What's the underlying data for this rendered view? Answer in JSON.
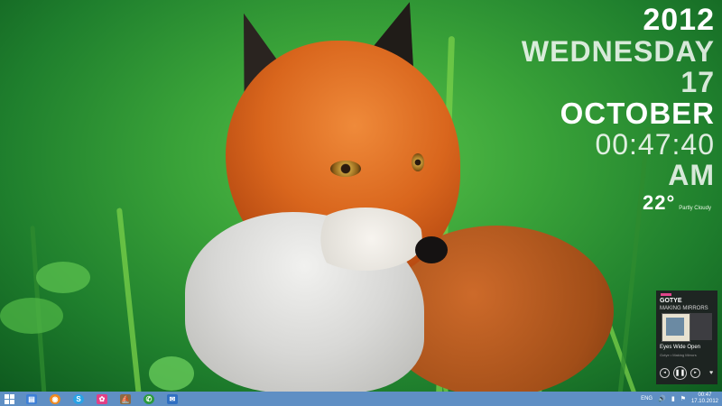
{
  "widget_clock": {
    "year": "2012",
    "weekday": "WEDNESDAY",
    "day": "17",
    "month": "OCTOBER",
    "time": "00:47:40",
    "ampm": "AM"
  },
  "weather": {
    "temperature": "22°",
    "condition": "Partly Cloudy"
  },
  "music": {
    "artist": "GOTYE",
    "album": "MAKING MIRRORS",
    "track": "Eyes Wide Open",
    "sub": "Gotye • Making Mirrors"
  },
  "taskbar": {
    "icons": [
      "windows-start-icon",
      "explorer-icon",
      "firefox-icon",
      "skype-icon",
      "flower-app-icon",
      "ship-app-icon",
      "chat-app-icon",
      "mail-app-icon"
    ],
    "language": "ENG",
    "time": "00:47",
    "date": "17.10.2012",
    "accent": "#5f8fc4"
  }
}
